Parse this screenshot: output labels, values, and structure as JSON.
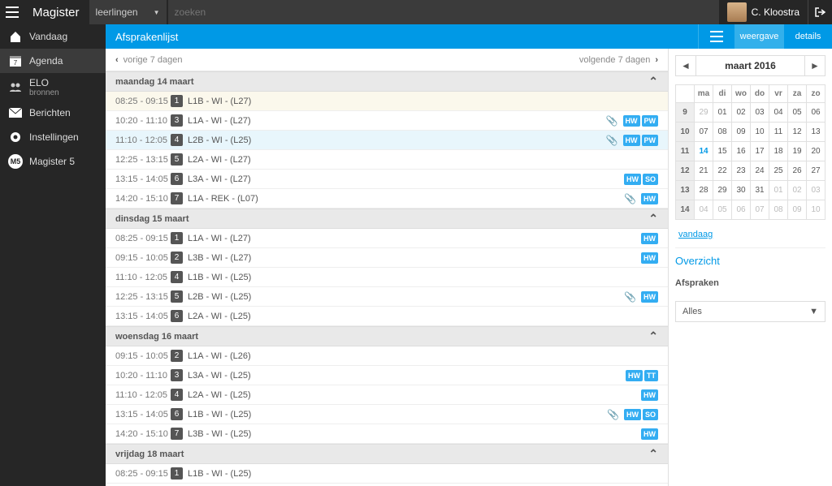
{
  "app": {
    "brand": "Magister",
    "scope": "leerlingen",
    "search_placeholder": "zoeken",
    "user": "C. Kloostra"
  },
  "nav": {
    "items": [
      {
        "label": "Vandaag"
      },
      {
        "label": "Agenda"
      },
      {
        "label": "ELO",
        "sub": "bronnen"
      },
      {
        "label": "Berichten"
      },
      {
        "label": "Instellingen"
      },
      {
        "label": "Magister 5"
      }
    ]
  },
  "header": {
    "title": "Afsprakenlijst",
    "tabs": {
      "weergave": "weergave",
      "details": "details"
    }
  },
  "pager": {
    "prev": "vorige 7 dagen",
    "next": "volgende 7 dagen"
  },
  "days": [
    {
      "name": "maandag 14 maart",
      "rows": [
        {
          "time": "08:25 - 09:15",
          "period": "1",
          "subj": "L1B - WI - (L27)",
          "badges": [],
          "clip": false,
          "first": true
        },
        {
          "time": "10:20 - 11:10",
          "period": "3",
          "subj": "L1A - WI - (L27)",
          "badges": [
            "HW",
            "PW"
          ],
          "clip": true
        },
        {
          "time": "11:10 - 12:05",
          "period": "4",
          "subj": "L2B - WI - (L25)",
          "badges": [
            "HW",
            "PW"
          ],
          "clip": true,
          "sel": true
        },
        {
          "time": "12:25 - 13:15",
          "period": "5",
          "subj": "L2A - WI - (L27)",
          "badges": [],
          "clip": false
        },
        {
          "time": "13:15 - 14:05",
          "period": "6",
          "subj": "L3A - WI - (L27)",
          "badges": [
            "HW",
            "SO"
          ],
          "clip": false
        },
        {
          "time": "14:20 - 15:10",
          "period": "7",
          "subj": "L1A - REK - (L07)",
          "badges": [
            "HW"
          ],
          "clip": true
        }
      ]
    },
    {
      "name": "dinsdag 15 maart",
      "rows": [
        {
          "time": "08:25 - 09:15",
          "period": "1",
          "subj": "L1A - WI - (L27)",
          "badges": [
            "HW"
          ],
          "clip": false
        },
        {
          "time": "09:15 - 10:05",
          "period": "2",
          "subj": "L3B - WI - (L27)",
          "badges": [
            "HW"
          ],
          "clip": false
        },
        {
          "time": "11:10 - 12:05",
          "period": "4",
          "subj": "L1B - WI - (L25)",
          "badges": [],
          "clip": false
        },
        {
          "time": "12:25 - 13:15",
          "period": "5",
          "subj": "L2B - WI - (L25)",
          "badges": [
            "HW"
          ],
          "clip": true
        },
        {
          "time": "13:15 - 14:05",
          "period": "6",
          "subj": "L2A - WI - (L25)",
          "badges": [],
          "clip": false
        }
      ]
    },
    {
      "name": "woensdag 16 maart",
      "rows": [
        {
          "time": "09:15 - 10:05",
          "period": "2",
          "subj": "L1A - WI - (L26)",
          "badges": [],
          "clip": false
        },
        {
          "time": "10:20 - 11:10",
          "period": "3",
          "subj": "L3A - WI - (L25)",
          "badges": [
            "HW",
            "TT"
          ],
          "clip": false
        },
        {
          "time": "11:10 - 12:05",
          "period": "4",
          "subj": "L2A - WI - (L25)",
          "badges": [
            "HW"
          ],
          "clip": false
        },
        {
          "time": "13:15 - 14:05",
          "period": "6",
          "subj": "L1B - WI - (L25)",
          "badges": [
            "HW",
            "SO"
          ],
          "clip": true
        },
        {
          "time": "14:20 - 15:10",
          "period": "7",
          "subj": "L3B - WI - (L25)",
          "badges": [
            "HW"
          ],
          "clip": false
        }
      ]
    },
    {
      "name": "vrijdag 18 maart",
      "rows": [
        {
          "time": "08:25 - 09:15",
          "period": "1",
          "subj": "L1B - WI - (L25)",
          "badges": [],
          "clip": false
        }
      ]
    }
  ],
  "calendar": {
    "month": "maart 2016",
    "dow": [
      "ma",
      "di",
      "wo",
      "do",
      "vr",
      "za",
      "zo"
    ],
    "weeks": [
      {
        "wk": "9",
        "days": [
          {
            "d": "29",
            "off": true
          },
          {
            "d": "01"
          },
          {
            "d": "02"
          },
          {
            "d": "03"
          },
          {
            "d": "04"
          },
          {
            "d": "05"
          },
          {
            "d": "06"
          }
        ]
      },
      {
        "wk": "10",
        "days": [
          {
            "d": "07"
          },
          {
            "d": "08"
          },
          {
            "d": "09"
          },
          {
            "d": "10"
          },
          {
            "d": "11"
          },
          {
            "d": "12"
          },
          {
            "d": "13"
          }
        ]
      },
      {
        "wk": "11",
        "days": [
          {
            "d": "14",
            "today": true
          },
          {
            "d": "15"
          },
          {
            "d": "16"
          },
          {
            "d": "17"
          },
          {
            "d": "18"
          },
          {
            "d": "19"
          },
          {
            "d": "20"
          }
        ]
      },
      {
        "wk": "12",
        "days": [
          {
            "d": "21"
          },
          {
            "d": "22"
          },
          {
            "d": "23"
          },
          {
            "d": "24"
          },
          {
            "d": "25"
          },
          {
            "d": "26"
          },
          {
            "d": "27"
          }
        ]
      },
      {
        "wk": "13",
        "days": [
          {
            "d": "28"
          },
          {
            "d": "29"
          },
          {
            "d": "30"
          },
          {
            "d": "31"
          },
          {
            "d": "01",
            "off": true
          },
          {
            "d": "02",
            "off": true
          },
          {
            "d": "03",
            "off": true
          }
        ]
      },
      {
        "wk": "14",
        "days": [
          {
            "d": "04",
            "off": true
          },
          {
            "d": "05",
            "off": true
          },
          {
            "d": "06",
            "off": true
          },
          {
            "d": "07",
            "off": true
          },
          {
            "d": "08",
            "off": true
          },
          {
            "d": "09",
            "off": true
          },
          {
            "d": "10",
            "off": true
          }
        ]
      }
    ],
    "today_link": "vandaag"
  },
  "overview": {
    "title": "Overzicht",
    "subtitle": "Afspraken",
    "selected": "Alles"
  }
}
